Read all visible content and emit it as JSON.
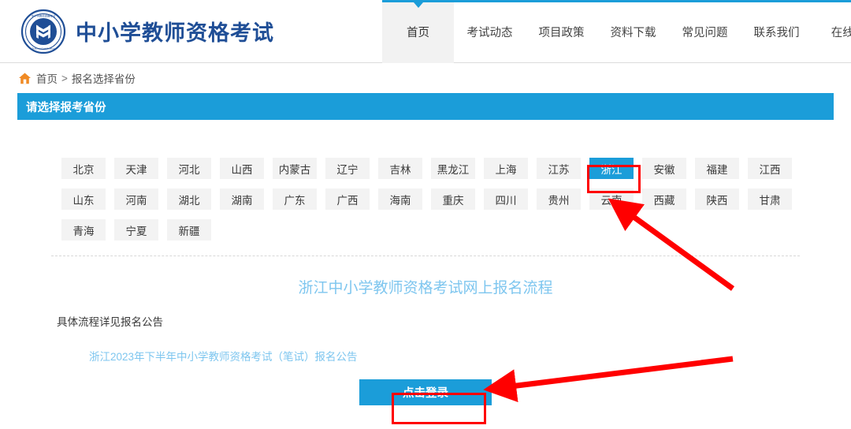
{
  "header": {
    "logo_icon": "emblem-logo-icon",
    "title": "中小学教师资格考试",
    "nav": [
      {
        "label": "首页",
        "active": true
      },
      {
        "label": "考试动态",
        "active": false
      },
      {
        "label": "项目政策",
        "active": false
      },
      {
        "label": "资料下载",
        "active": false
      },
      {
        "label": "常见问题",
        "active": false
      },
      {
        "label": "联系我们",
        "active": false
      },
      {
        "label": "在线咨",
        "active": false
      }
    ]
  },
  "breadcrumb": {
    "home_icon": "home-icon",
    "home": "首页",
    "separator": ">",
    "current": "报名选择省份"
  },
  "section": {
    "bar_title": "请选择报考省份",
    "bar_color": "#1b9dd9"
  },
  "provinces": {
    "selected": "浙江",
    "selected_color": "#1b9dd9",
    "rows": [
      [
        "北京",
        "天津",
        "河北",
        "山西",
        "内蒙古",
        "辽宁",
        "吉林",
        "黑龙江",
        "上海",
        "江苏",
        "浙江",
        "安徽",
        "福建",
        "江西"
      ],
      [
        "山东",
        "河南",
        "湖北",
        "湖南",
        "广东",
        "广西",
        "海南",
        "重庆",
        "四川",
        "贵州",
        "云南",
        "西藏",
        "陕西",
        "甘肃"
      ],
      [
        "青海",
        "宁夏",
        "新疆"
      ]
    ]
  },
  "flow": {
    "title": "浙江中小学教师资格考试网上报名流程",
    "title_color": "#7ec6ef",
    "note": "具体流程详见报名公告",
    "announcement_link": "浙江2023年下半年中小学教师资格考试（笔试）报名公告",
    "login_label": "点击登录"
  },
  "annotations": {
    "color": "#ff0000",
    "boxes": [
      "province-zhejiang",
      "login-button"
    ],
    "arrows": [
      "arrow-to-province",
      "arrow-to-login"
    ]
  }
}
